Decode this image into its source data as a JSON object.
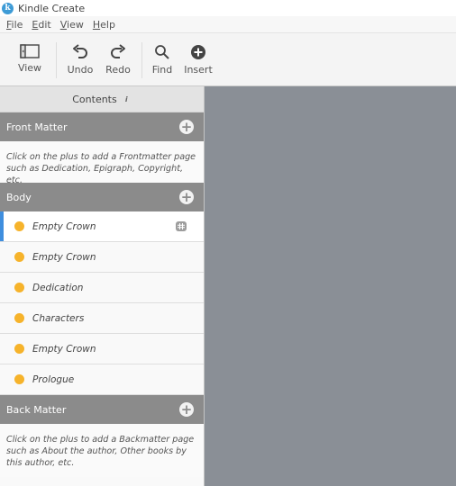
{
  "app": {
    "title": "Kindle Create",
    "icon_letter": "k"
  },
  "menu": [
    {
      "u": "F",
      "rest": "ile"
    },
    {
      "u": "E",
      "rest": "dit"
    },
    {
      "u": "V",
      "rest": "iew"
    },
    {
      "u": "H",
      "rest": "elp"
    }
  ],
  "toolbar": {
    "view_label": "View",
    "undo_label": "Undo",
    "redo_label": "Redo",
    "find_label": "Find",
    "insert_label": "Insert"
  },
  "sidebar": {
    "contents_label": "Contents",
    "info_glyph": "i",
    "front": {
      "label": "Front Matter",
      "hint": "Click on the plus to add a Frontmatter page such as Dedication, Epigraph, Copyright, etc."
    },
    "body": {
      "label": "Body",
      "items": [
        {
          "label": "Empty Crown"
        },
        {
          "label": "Empty Crown"
        },
        {
          "label": "Dedication"
        },
        {
          "label": "Characters"
        },
        {
          "label": "Empty Crown"
        },
        {
          "label": "Prologue"
        }
      ]
    },
    "back": {
      "label": "Back Matter",
      "hint": "Click on the plus to add a Backmatter page such as About the author, Other books by this author, etc."
    }
  },
  "colors": {
    "accent": "#3f8ede",
    "status_dot": "#f6b32b",
    "section_header": "#8b8b8b",
    "canvas": "#8a8f96"
  }
}
